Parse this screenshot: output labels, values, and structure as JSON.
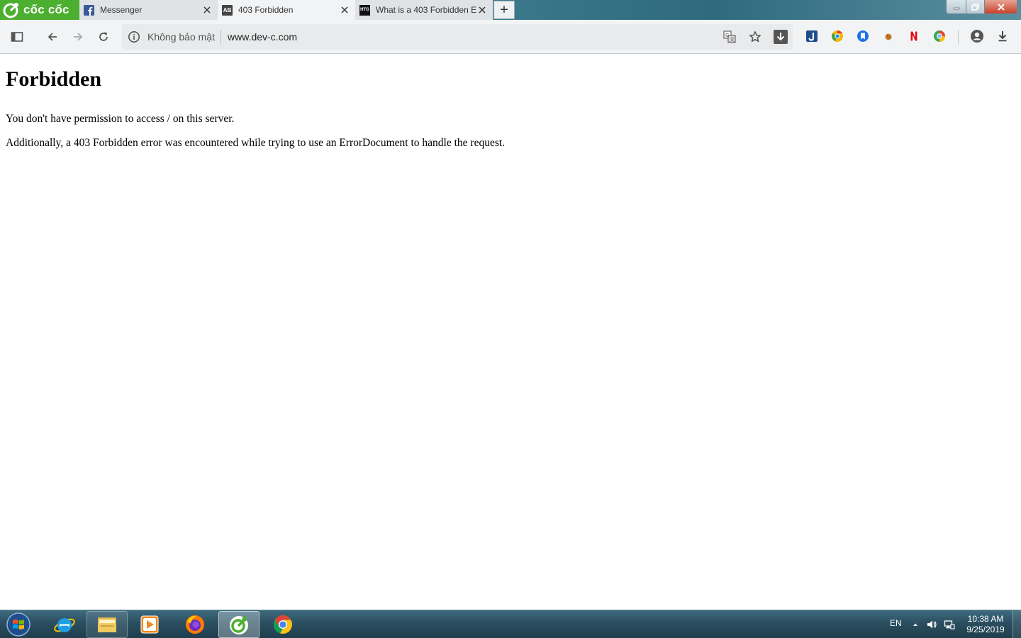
{
  "browser": {
    "brand": "cốc cốc",
    "tabs": [
      {
        "title": "Messenger",
        "favicon": "facebook-icon",
        "active": false
      },
      {
        "title": "403 Forbidden",
        "favicon": "ab-icon",
        "favicon_text": "AB",
        "active": true
      },
      {
        "title": "What is a 403 Forbidden E",
        "favicon": "htg-icon",
        "favicon_text": "HTG",
        "active": false
      }
    ],
    "new_tab_label": "+"
  },
  "toolbar": {
    "security_label": "Không bảo mật",
    "url": "www.dev-c.com"
  },
  "page": {
    "heading": "Forbidden",
    "paragraph1": "You don't have permission to access / on this server.",
    "paragraph2": "Additionally, a 403 Forbidden error was encountered while trying to use an ErrorDocument to handle the request."
  },
  "taskbar": {
    "language": "EN",
    "time": "10:38 AM",
    "date": "9/25/2019"
  },
  "colors": {
    "brand_green": "#4caf2f",
    "taskbar": "#2b4f60"
  }
}
